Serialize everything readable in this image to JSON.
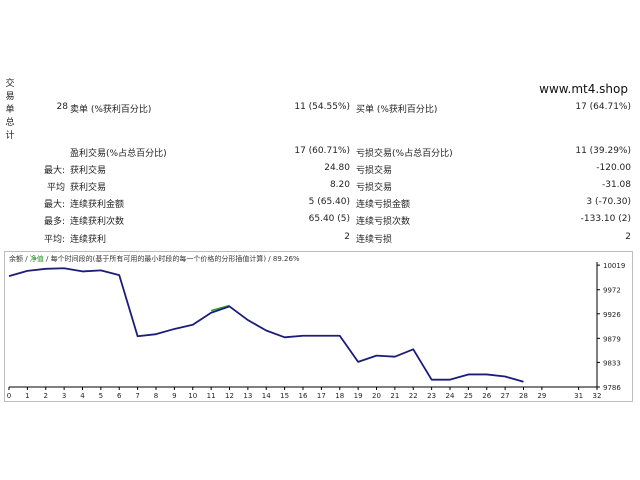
{
  "side_label": [
    "交",
    "易",
    "单",
    "总",
    "计"
  ],
  "website": "www.mt4.shop",
  "rows": [
    {
      "c1": "28",
      "c2": "卖单 (%获利百分比)",
      "c3": "11 (54.55%)",
      "c4": "买单 (%获利百分比)",
      "c5": "17 (64.71%)"
    },
    {
      "c1": "",
      "c2": "盈利交易(%占总百分比)",
      "c3": "17 (60.71%)",
      "c4": "亏损交易(%占总百分比)",
      "c5": "11 (39.29%)"
    },
    {
      "c1": "最大:",
      "c2": "获利交易",
      "c3": "24.80",
      "c4": "亏损交易",
      "c5": "-120.00"
    },
    {
      "c1": "平均",
      "c2": "获利交易",
      "c3": "8.20",
      "c4": "亏损交易",
      "c5": "-31.08"
    },
    {
      "c1": "最大:",
      "c2": "连续获利金额",
      "c3": "5 (65.40)",
      "c4": "连续亏损金额",
      "c5": "3 (-70.30)"
    },
    {
      "c1": "最多:",
      "c2": "连续获利次数",
      "c3": "65.40 (5)",
      "c4": "连续亏损次数",
      "c5": "-133.10 (2)"
    },
    {
      "c1": "平均:",
      "c2": "连续获利",
      "c3": "2",
      "c4": "连续亏损",
      "c5": "2"
    }
  ],
  "chart_header": {
    "part1": "余额",
    "sep1": " / ",
    "part2": "净值",
    "sep2": " / ",
    "part3": "每个时间段的(基于所有可用的最小时段的每一个价格的分形插值计算) / 89.26%"
  },
  "chart_data": {
    "type": "line",
    "x": [
      0,
      1,
      2,
      3,
      4,
      5,
      6,
      7,
      8,
      9,
      10,
      11,
      12,
      13,
      14,
      15,
      16,
      17,
      18,
      19,
      20,
      21,
      22,
      23,
      24,
      25,
      26,
      27,
      28
    ],
    "series": [
      {
        "values": [
          9998,
          10008,
          10012,
          10013,
          10007,
          10009,
          10000,
          9883,
          9887,
          9897,
          9905,
          9928,
          9940,
          9914,
          9894,
          9881,
          9884,
          9884,
          9884,
          9834,
          9846,
          9844,
          9858,
          9800,
          9800,
          9810,
          9810,
          9806,
          9796
        ]
      }
    ],
    "equity_deviation": {
      "x_start": 11,
      "x_end": 12,
      "values": [
        9932,
        9942
      ]
    },
    "y_ticks": [
      10019,
      9972,
      9926,
      9879,
      9833,
      9786
    ],
    "x_ticks": [
      0,
      1,
      2,
      3,
      4,
      5,
      6,
      7,
      8,
      9,
      10,
      11,
      12,
      13,
      14,
      15,
      16,
      17,
      18,
      19,
      20,
      21,
      22,
      23,
      24,
      25,
      26,
      27,
      28,
      29,
      31,
      32
    ],
    "xlim": [
      0,
      32
    ],
    "ylim": [
      9786,
      10025
    ],
    "line_color": "#1c1c7a",
    "equity_color": "#2e9e2e"
  }
}
